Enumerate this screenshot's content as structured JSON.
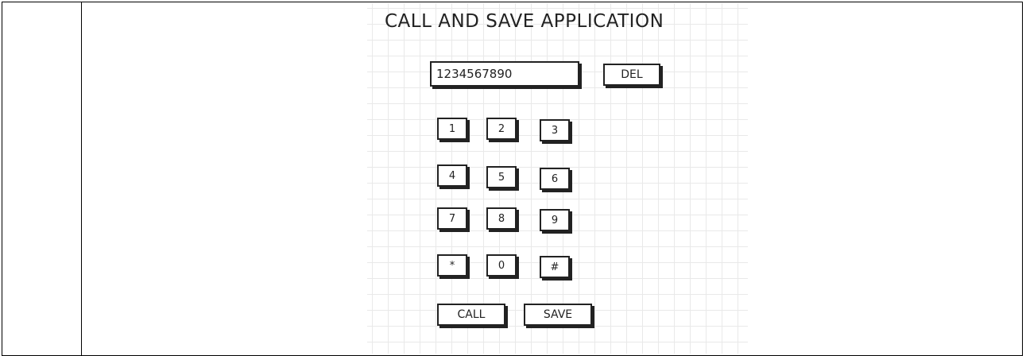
{
  "app": {
    "title": "CALL AND SAVE APPLICATION"
  },
  "number_field": {
    "value": "1234567890"
  },
  "buttons": {
    "delete_label": "DEL",
    "call_label": "CALL",
    "save_label": "SAVE"
  },
  "keypad": {
    "keys": [
      "1",
      "2",
      "3",
      "4",
      "5",
      "6",
      "7",
      "8",
      "9",
      "*",
      "0",
      "#"
    ]
  },
  "colors": {
    "ink": "#222222",
    "grid": "#e9e9e9"
  }
}
